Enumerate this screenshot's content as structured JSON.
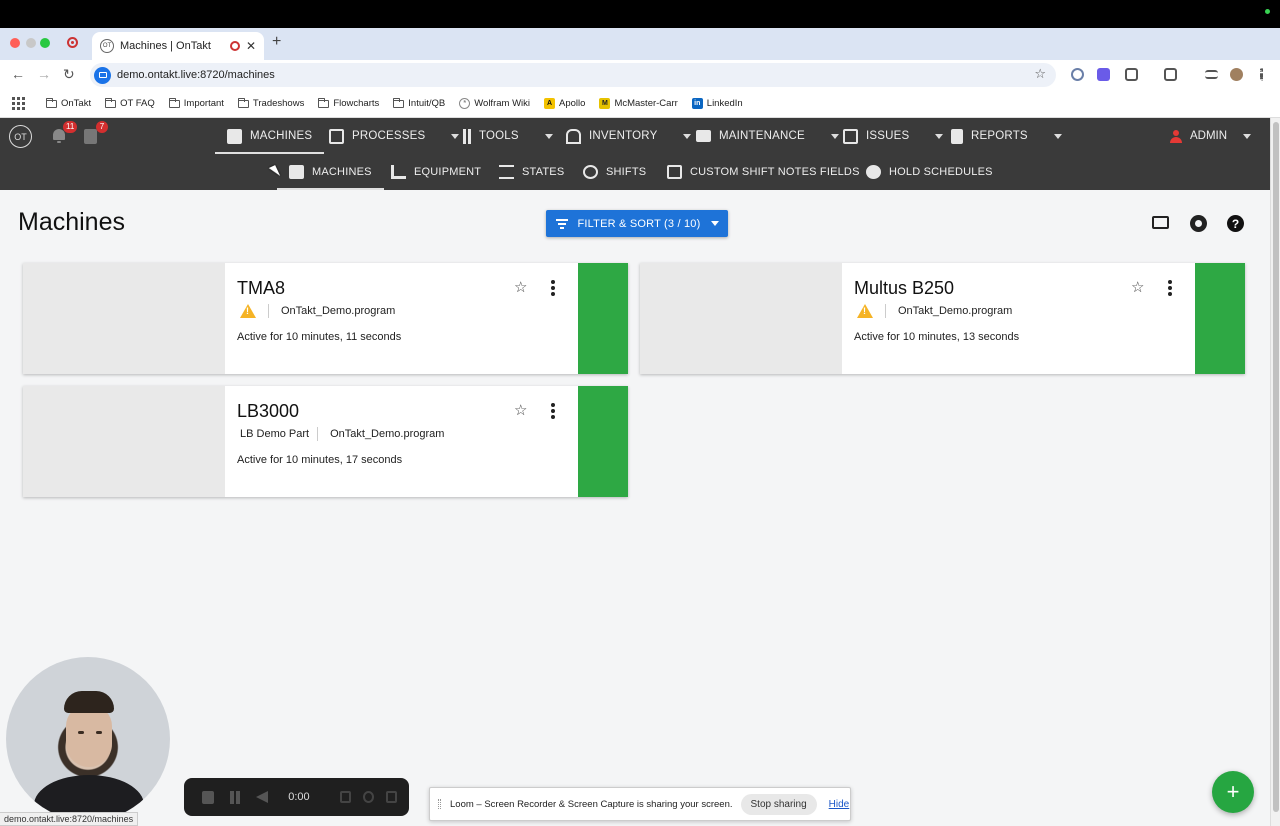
{
  "browser": {
    "tab_title": "Machines | OnTakt",
    "tab_favicon": "OT",
    "url": "demo.ontakt.live:8720/machines",
    "new_tab": "+",
    "close": "✕",
    "bookmarks": [
      {
        "label": "OnTakt",
        "icon": "folder-icon"
      },
      {
        "label": "OT FAQ",
        "icon": "folder-icon"
      },
      {
        "label": "Important",
        "icon": "folder-icon"
      },
      {
        "label": "Tradeshows",
        "icon": "folder-icon"
      },
      {
        "label": "Flowcharts",
        "icon": "folder-icon"
      },
      {
        "label": "Intuit/QB",
        "icon": "folder-icon"
      },
      {
        "label": "Wolfram Wiki",
        "icon": "wolfram-icon"
      },
      {
        "label": "Apollo",
        "icon": "apollo-icon"
      },
      {
        "label": "McMaster-Carr",
        "icon": "mcmaster-icon"
      },
      {
        "label": "LinkedIn",
        "icon": "linkedin-icon"
      }
    ],
    "status_url": "demo.ontakt.live:8720/machines"
  },
  "app": {
    "logo": "OT",
    "notifications_count": "11",
    "tasks_count": "7",
    "top_nav": [
      {
        "label": "MACHINES",
        "icon": "machines-icon",
        "active": true,
        "dropdown": false
      },
      {
        "label": "PROCESSES",
        "icon": "processes-icon",
        "dropdown": true
      },
      {
        "label": "TOOLS",
        "icon": "tools-icon",
        "dropdown": true
      },
      {
        "label": "INVENTORY",
        "icon": "warehouse-icon",
        "dropdown": true
      },
      {
        "label": "MAINTENANCE",
        "icon": "toolbox-icon",
        "dropdown": true
      },
      {
        "label": "ISSUES",
        "icon": "alert-box-icon",
        "dropdown": true
      },
      {
        "label": "REPORTS",
        "icon": "document-icon",
        "dropdown": true
      }
    ],
    "user_label": "ADMIN",
    "sub_nav": [
      {
        "label": "MACHINES",
        "icon": "machines-icon",
        "active": true
      },
      {
        "label": "EQUIPMENT",
        "icon": "equipment-icon"
      },
      {
        "label": "STATES",
        "icon": "states-icon"
      },
      {
        "label": "SHIFTS",
        "icon": "shifts-icon"
      },
      {
        "label": "CUSTOM SHIFT NOTES FIELDS",
        "icon": "custom-fields-icon"
      },
      {
        "label": "HOLD SCHEDULES",
        "icon": "hold-schedule-icon"
      }
    ]
  },
  "page": {
    "title": "Machines",
    "filter_button": "FILTER & SORT (3 / 10)",
    "help": "?",
    "fab": "+"
  },
  "machines": [
    {
      "name": "TMA8",
      "part": "",
      "program": "OnTakt_Demo.program",
      "warning": true,
      "status_text": "Active for 10 minutes, 11 seconds",
      "status_color": "#2ea844"
    },
    {
      "name": "Multus B250",
      "part": "",
      "program": "OnTakt_Demo.program",
      "warning": true,
      "status_text": "Active for 10 minutes, 13 seconds",
      "status_color": "#2ea844"
    },
    {
      "name": "LB3000",
      "part": "LB Demo Part",
      "program": "OnTakt_Demo.program",
      "warning": false,
      "status_text": "Active for 10 minutes, 17 seconds",
      "status_color": "#2ea844"
    }
  ],
  "loom": {
    "timer": "0:00",
    "share_message": "Loom – Screen Recorder & Screen Capture is sharing your screen.",
    "stop_sharing": "Stop sharing",
    "hide": "Hide"
  },
  "colors": {
    "accent_blue": "#1e73d8",
    "nav_bg": "#3a3a3a",
    "active_green": "#2ea844",
    "warning": "#f5b325",
    "badge_red": "#d32f2f"
  }
}
